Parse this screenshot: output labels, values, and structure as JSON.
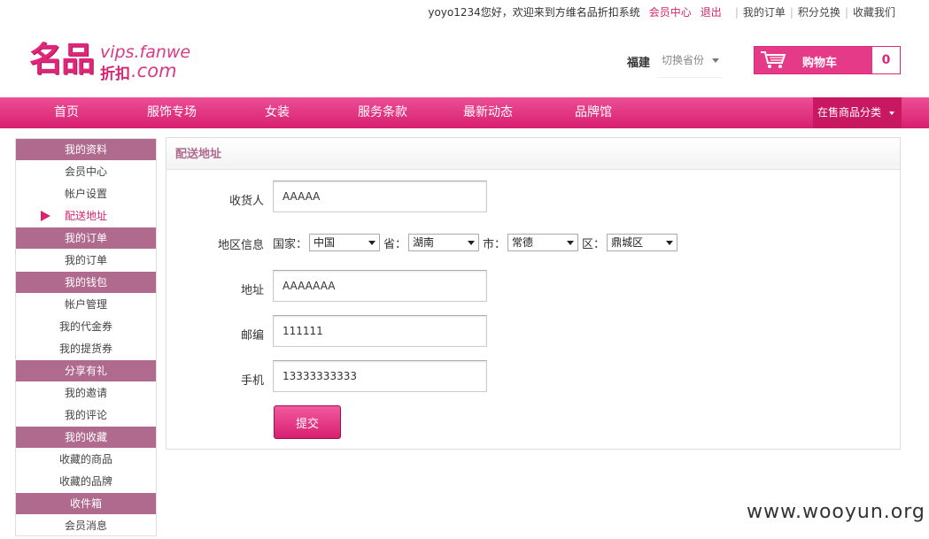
{
  "topbar": {
    "welcome": "yoyo1234您好，欢迎来到方维名品折扣系统",
    "member_center": "会员中心",
    "logout": "退出",
    "my_orders": "我的订单",
    "points_exchange": "积分兑换",
    "bookmark": "收藏我们"
  },
  "logo": {
    "main": "名品",
    "site_top": "vips.fanwe",
    "sub": "折扣",
    "site_bottom": ".com"
  },
  "header": {
    "province": "福建",
    "switch_label": "切换省份",
    "cart_label": "购物车",
    "cart_count": "0"
  },
  "nav": {
    "items": [
      "首页",
      "服饰专场",
      "女装",
      "服务条款",
      "最新动态",
      "品牌馆"
    ],
    "category": "在售商品分类"
  },
  "sidebar": {
    "g1": "我的资料",
    "g1_items": [
      "会员中心",
      "帐户设置",
      "配送地址"
    ],
    "g2": "我的订单",
    "g2_items": [
      "我的订单"
    ],
    "g3": "我的钱包",
    "g3_items": [
      "帐户管理",
      "我的代金券",
      "我的提货券"
    ],
    "g4": "分享有礼",
    "g4_items": [
      "我的邀请",
      "我的评论"
    ],
    "g5": "我的收藏",
    "g5_items": [
      "收藏的商品",
      "收藏的品牌"
    ],
    "g6": "收件箱",
    "g6_items": [
      "会员消息"
    ]
  },
  "panel": {
    "title": "配送地址",
    "consignee_label": "收货人",
    "consignee_value": "AAAAA",
    "region_label": "地区信息",
    "country_label": "国家：",
    "country_value": "中国",
    "province_label": "省：",
    "province_value": "湖南",
    "city_label": "市：",
    "city_value": "常德",
    "district_label": "区：",
    "district_value": "鼎城区",
    "address_label": "地址",
    "address_value": "AAAAAAA",
    "zip_label": "邮编",
    "zip_value": "111111",
    "mobile_label": "手机",
    "mobile_value": "13333333333",
    "submit_label": "提交"
  },
  "watermark": "www.wooyun.org",
  "colors": {
    "brand": "#e0267a",
    "sidebar_group": "#b06a8d"
  }
}
